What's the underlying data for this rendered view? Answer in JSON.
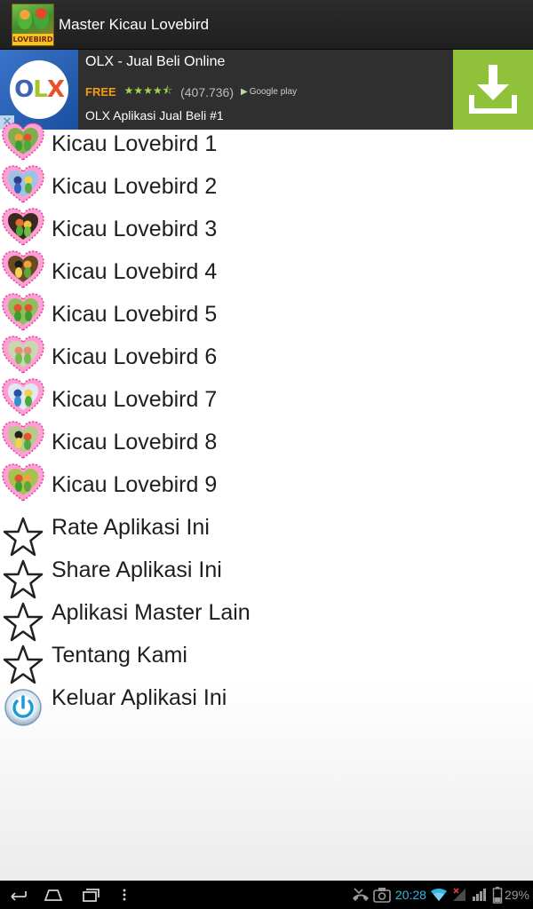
{
  "app": {
    "title": "Master Kicau Lovebird",
    "icon_brand": "LOVEBIRD"
  },
  "ad": {
    "title": "OLX - Jual Beli Online",
    "price": "FREE",
    "stars": "★★★★⯪",
    "rating": 4.5,
    "rating_count": "(407.736)",
    "store": "Google play",
    "subtitle": "OLX Aplikasi Jual Beli #1",
    "close_symbol": "✕",
    "colors": {
      "download_bg": "#8fc13a",
      "price": "#f39c12"
    }
  },
  "menu": {
    "items": [
      {
        "label": "Kicau Lovebird 1",
        "icon": "lovebird-heart-icon"
      },
      {
        "label": "Kicau Lovebird 2",
        "icon": "lovebird-heart-icon"
      },
      {
        "label": "Kicau Lovebird 3",
        "icon": "lovebird-heart-icon"
      },
      {
        "label": "Kicau Lovebird 4",
        "icon": "lovebird-heart-icon"
      },
      {
        "label": "Kicau Lovebird 5",
        "icon": "lovebird-heart-icon"
      },
      {
        "label": "Kicau Lovebird 6",
        "icon": "lovebird-heart-icon"
      },
      {
        "label": "Kicau Lovebird 7",
        "icon": "lovebird-heart-icon"
      },
      {
        "label": "Kicau Lovebird 8",
        "icon": "lovebird-heart-icon"
      },
      {
        "label": "Kicau Lovebird 9",
        "icon": "lovebird-heart-icon"
      },
      {
        "label": "Rate Aplikasi Ini",
        "icon": "star-icon"
      },
      {
        "label": "Share Aplikasi Ini",
        "icon": "star-icon"
      },
      {
        "label": "Aplikasi Master Lain",
        "icon": "star-icon"
      },
      {
        "label": "Tentang Kami",
        "icon": "star-icon"
      },
      {
        "label": "Keluar Aplikasi Ini",
        "icon": "power-icon"
      }
    ]
  },
  "status_bar": {
    "time": "20:28",
    "battery": "29%",
    "icons": [
      "missed-call-icon",
      "screenshot-icon",
      "wifi-icon",
      "signal-off-icon",
      "signal-icon",
      "battery-icon"
    ]
  },
  "nav": {
    "buttons": [
      "back-icon",
      "home-icon",
      "recent-apps-icon",
      "menu-icon"
    ]
  }
}
